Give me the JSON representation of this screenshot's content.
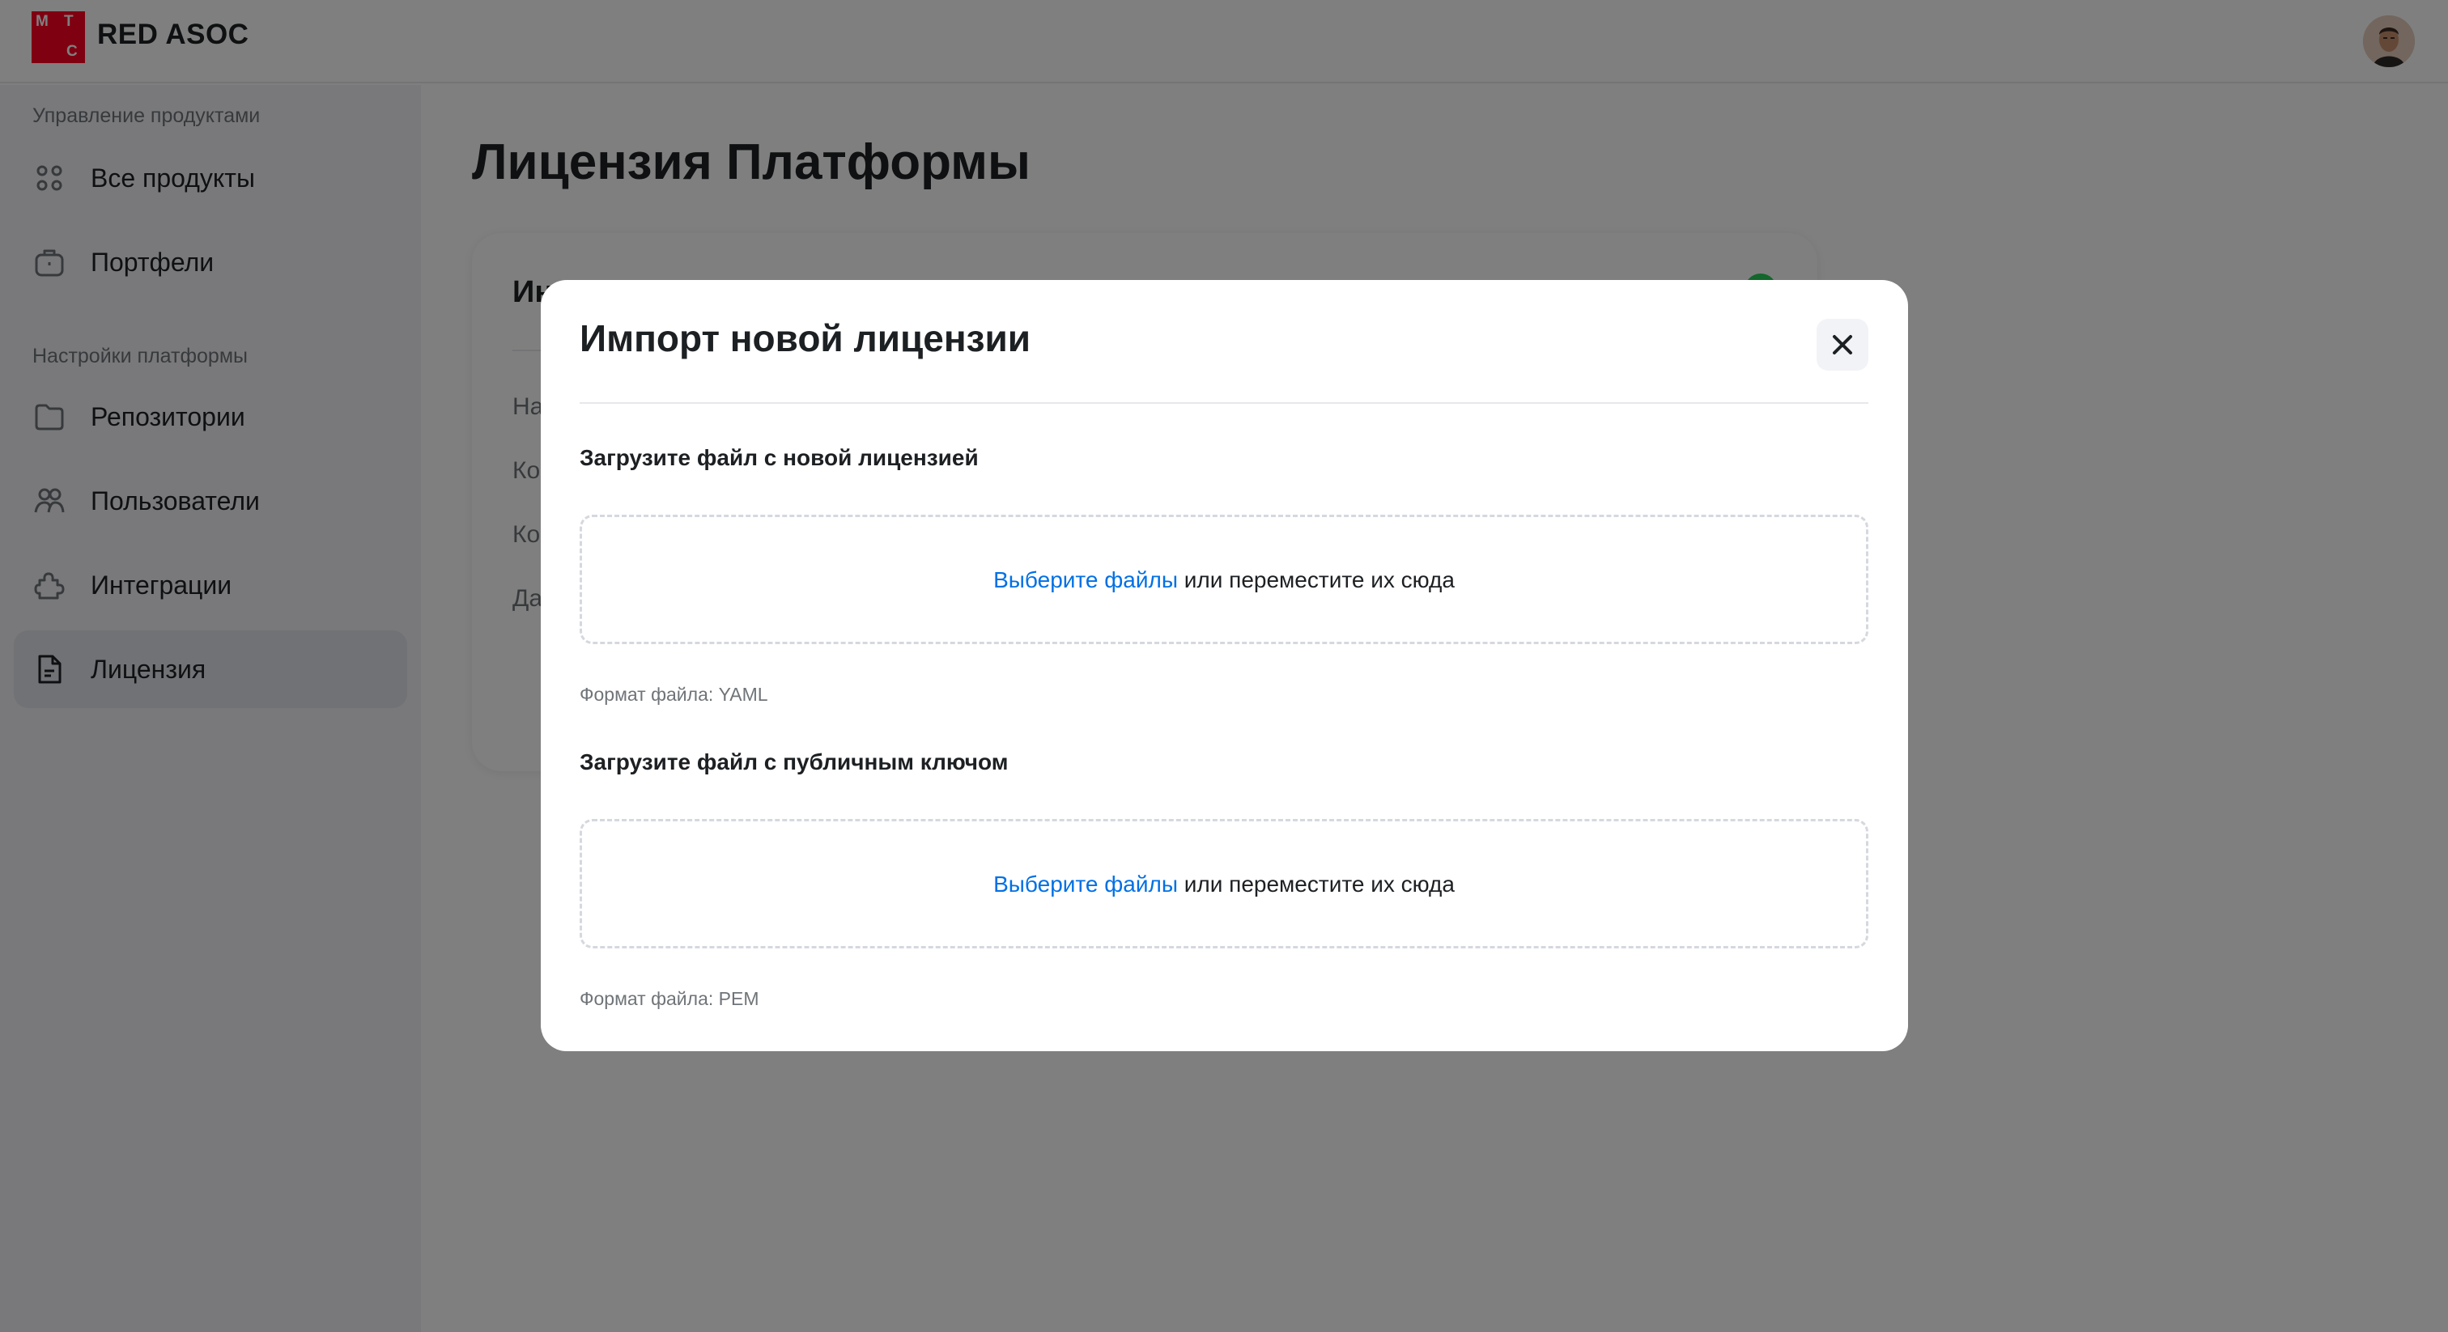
{
  "header": {
    "logo_letters": [
      "М",
      "Т",
      "С"
    ],
    "brand": "RED ASOC"
  },
  "sidebar": {
    "sections": [
      {
        "title": "Управление продуктами",
        "items": [
          {
            "label": "Все продукты",
            "icon": "grid-icon"
          },
          {
            "label": "Портфели",
            "icon": "briefcase-icon"
          }
        ]
      },
      {
        "title": "Настройки платформы",
        "items": [
          {
            "label": "Репозитории",
            "icon": "folder-icon"
          },
          {
            "label": "Пользователи",
            "icon": "users-icon"
          },
          {
            "label": "Интеграции",
            "icon": "puzzle-icon"
          },
          {
            "label": "Лицензия",
            "icon": "document-icon",
            "active": true
          }
        ]
      }
    ]
  },
  "main": {
    "title": "Лицензия Платформы",
    "card": {
      "title_visible": "Ин",
      "rows_visible": [
        "На",
        "Ко",
        "Ко",
        "Да"
      ]
    }
  },
  "modal": {
    "title": "Импорт новой лицензии",
    "license_field": {
      "label": "Загрузите файл с новой лицензией",
      "link": "Выберите файлы",
      "text": " или переместите их сюда",
      "hint": "Формат файла: YAML"
    },
    "key_field": {
      "label": "Загрузите файл с публичным ключом",
      "link": "Выберите файлы",
      "text": " или переместите их сюда",
      "hint": "Формат файла: PEM"
    }
  },
  "colors": {
    "brand_red": "#ff0023",
    "link_blue": "#0070e5",
    "status_green": "#26cd58",
    "overlay": "rgba(0,0,0,0.5)"
  }
}
